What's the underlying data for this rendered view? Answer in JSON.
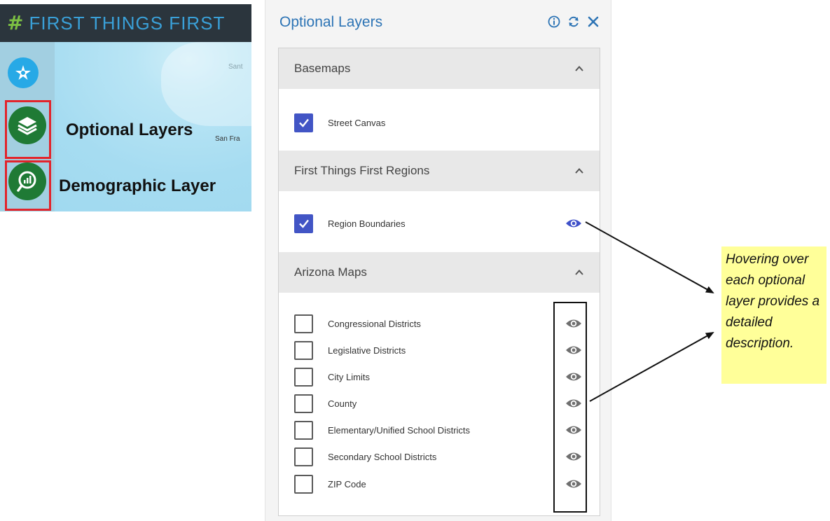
{
  "map": {
    "brand_symbol": "#",
    "brand_name": "FIRST THINGS FIRST",
    "city_label_1": "Sant",
    "city_label_2": "San Fra",
    "rail_labels": {
      "optional_layers": "Optional Layers",
      "demographic_layer": "Demographic Layer"
    },
    "rail_icons": [
      "star-compass-icon",
      "layers-icon",
      "demographic-search-icon"
    ]
  },
  "panel": {
    "title": "Optional Layers",
    "header_icons": [
      "info-icon",
      "refresh-icon",
      "close-icon"
    ],
    "sections": [
      {
        "label": "Basemaps",
        "layers": [
          {
            "label": "Street Canvas",
            "checked": true,
            "eye": false
          }
        ]
      },
      {
        "label": "First Things First Regions",
        "layers": [
          {
            "label": "Region Boundaries",
            "checked": true,
            "eye": true
          }
        ]
      },
      {
        "label": "Arizona Maps",
        "layers": [
          {
            "label": "Congressional Districts",
            "checked": false,
            "eye": true
          },
          {
            "label": "Legislative Districts",
            "checked": false,
            "eye": true
          },
          {
            "label": "City Limits",
            "checked": false,
            "eye": true
          },
          {
            "label": "County",
            "checked": false,
            "eye": true
          },
          {
            "label": "Elementary/Unified School Districts",
            "checked": false,
            "eye": true
          },
          {
            "label": "Secondary School Districts",
            "checked": false,
            "eye": true
          },
          {
            "label": "ZIP Code",
            "checked": false,
            "eye": true
          }
        ]
      }
    ]
  },
  "callout": {
    "text": "Hovering over each optional layer provides a detailed description."
  },
  "colors": {
    "title_blue": "#2d74b5",
    "checkbox_checked": "#4255c5",
    "eye_active": "#3f51c9",
    "eye_inactive": "#6f6f6f",
    "highlight_red": "#e3242b",
    "callout_bg": "#ffff99"
  }
}
